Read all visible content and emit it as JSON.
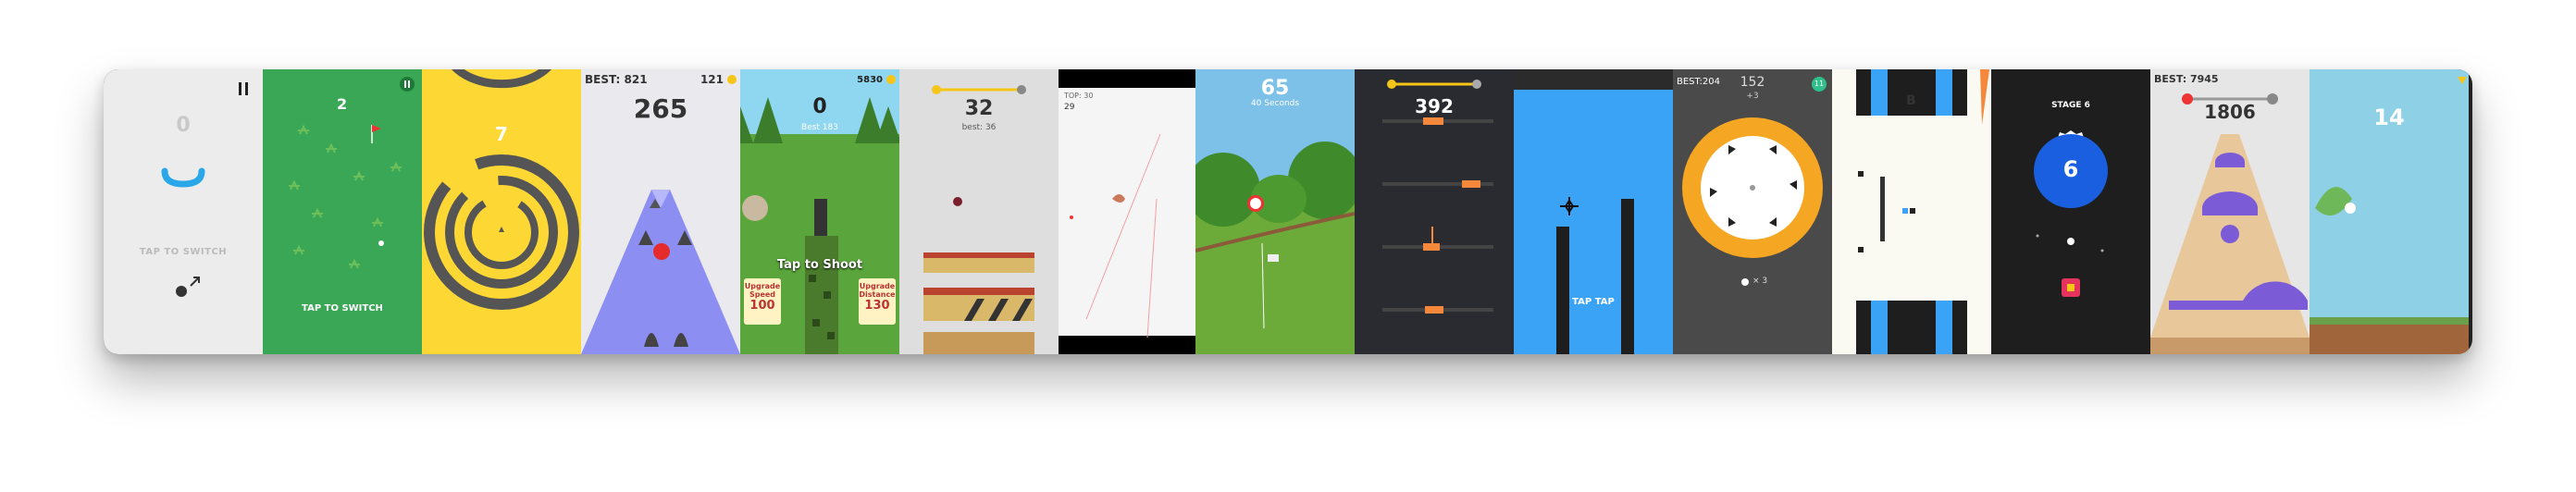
{
  "p1": {
    "score": "0",
    "prompt": "TAP TO SWITCH",
    "pause_icon": "pause-icon"
  },
  "p2": {
    "score": "2",
    "prompt": "TAP TO SWITCH"
  },
  "p3": {
    "score": "7"
  },
  "p4": {
    "best": "BEST: 821",
    "coins": "121",
    "score": "265"
  },
  "p5": {
    "coins": "5830",
    "score": "0",
    "best": "Best 183",
    "prompt": "Tap to Shoot",
    "btn_left": {
      "label": "Upgrade Speed",
      "value": "100"
    },
    "btn_right": {
      "label": "Upgrade Distance",
      "value": "130"
    }
  },
  "p6": {
    "score": "32",
    "best": "best: 36"
  },
  "p7": {
    "top": "TOP: 30",
    "score": "29"
  },
  "p8": {
    "score": "65",
    "subtitle": "40 Seconds"
  },
  "p9": {
    "score": "392"
  },
  "p10": {
    "prompt": "TAP TAP"
  },
  "p11": {
    "best": "BEST:204",
    "score": "152",
    "bonus": "+3",
    "lives": "× 3",
    "badge": "11"
  },
  "p12": {
    "letter": "B"
  },
  "p13": {
    "stage": "STAGE 6",
    "number": "6"
  },
  "p14": {
    "best": "BEST:  7945",
    "score": "1806"
  },
  "p15": {
    "score": "14"
  },
  "colors": {
    "yellow": "#fdd835",
    "green": "#3aa757",
    "blue": "#3aa3f5",
    "orange": "#f5a623"
  }
}
